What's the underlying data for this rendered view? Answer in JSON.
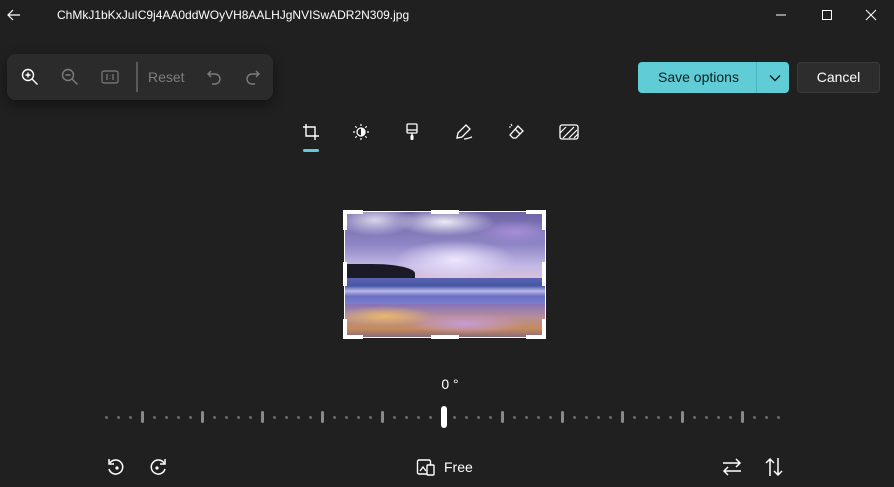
{
  "window": {
    "title": "ChMkJ1bKxJuIC9j4AA0ddWOyVH8AALHJgNVISwADR2N309.jpg",
    "icons": [
      "back-arrow-icon",
      "minimize-icon",
      "maximize-icon",
      "close-icon"
    ]
  },
  "zoom_toolbar": {
    "reset_label": "Reset",
    "icons": [
      "zoom-in-icon",
      "zoom-out-icon",
      "actual-size-icon",
      "undo-icon",
      "redo-icon"
    ]
  },
  "actions": {
    "save_label": "Save options",
    "cancel_label": "Cancel"
  },
  "edit_tools": {
    "active": "crop",
    "items": [
      "crop-icon",
      "adjustment-icon",
      "filter-icon",
      "markup-icon",
      "erase-icon",
      "background-icon"
    ]
  },
  "rotation": {
    "angle_label": "0 °"
  },
  "bottom_bar": {
    "aspect_label": "Free",
    "icons": [
      "rotate-left-icon",
      "rotate-right-icon",
      "aspect-ratio-icon",
      "flip-horizontal-icon",
      "flip-vertical-icon"
    ]
  },
  "colors": {
    "accent": "#60cdd6",
    "background": "#202020",
    "toolbar": "#2b2b2b"
  }
}
